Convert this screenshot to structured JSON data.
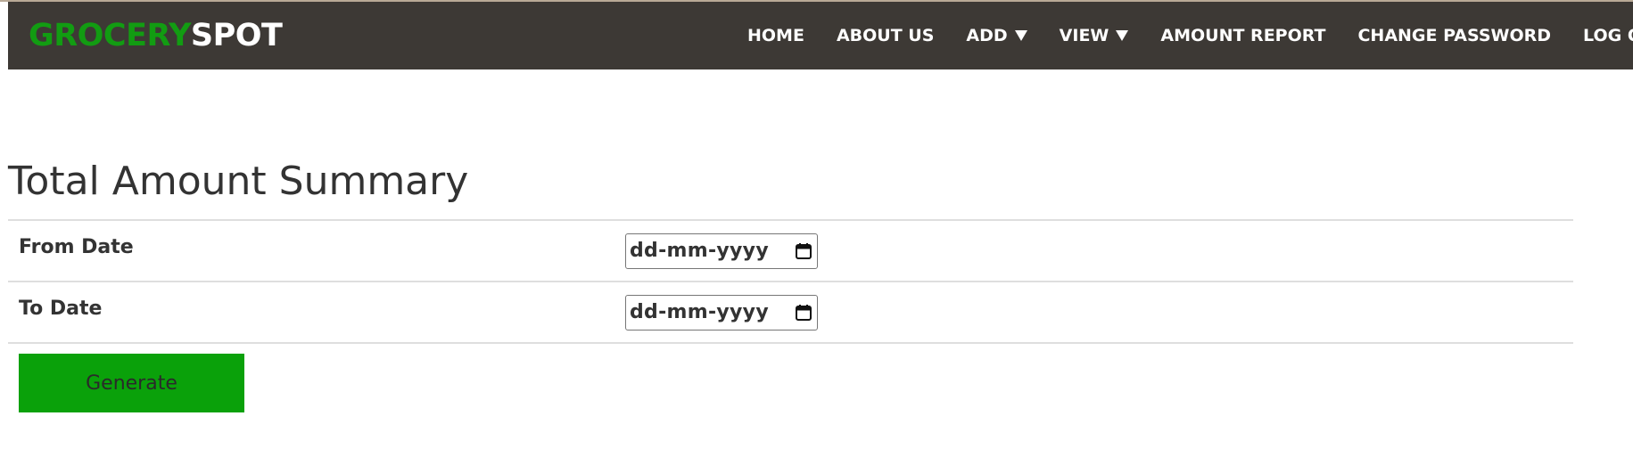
{
  "brand": {
    "part1": "GROCERY",
    "part2": "SPOT"
  },
  "nav": {
    "home": "HOME",
    "about": "ABOUT US",
    "add": "ADD",
    "view": "VIEW",
    "amount_report": "AMOUNT REPORT",
    "change_password": "CHANGE PASSWORD",
    "logout": "LOG OUT"
  },
  "page": {
    "title": "Total Amount Summary"
  },
  "form": {
    "from_label": "From Date",
    "from_value": "dd-mm-yyyy",
    "to_label": "To Date",
    "to_value": "dd-mm-yyyy",
    "generate_label": "Generate"
  },
  "colors": {
    "navbar_bg": "#3d3935",
    "brand_green": "#129c12",
    "button_green": "#0aa10a"
  },
  "icons": {
    "date_picker": "calendar-icon",
    "dropdown": "caret-down-icon"
  }
}
